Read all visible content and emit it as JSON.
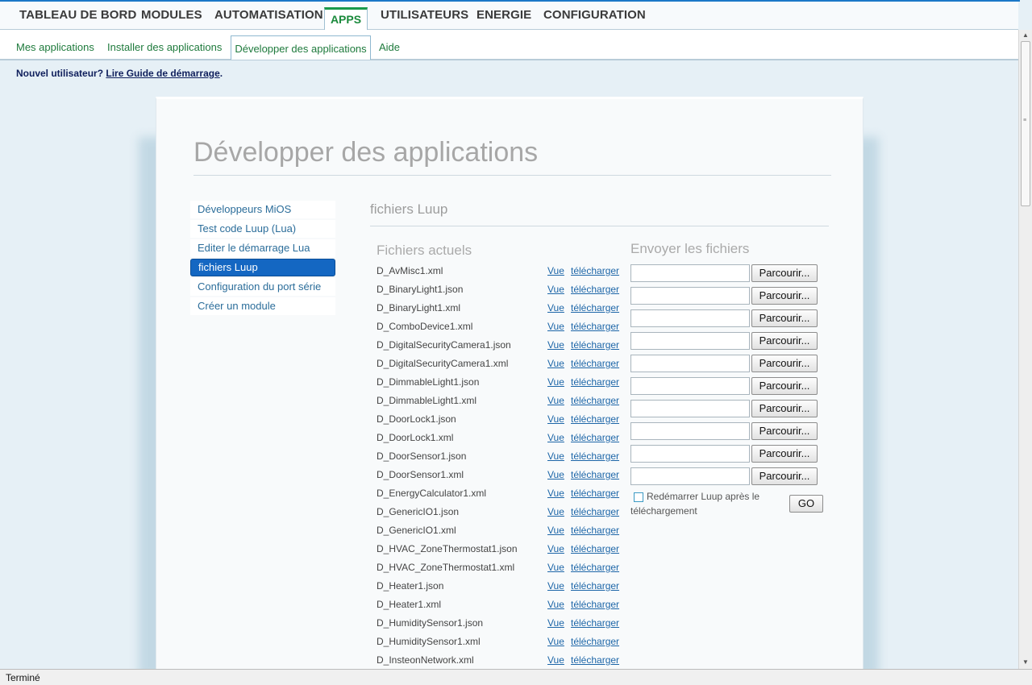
{
  "main_nav": {
    "items": [
      "TABLEAU DE BORD",
      "MODULES",
      "AUTOMATISATION",
      "UTILISATEURS",
      "ENERGIE",
      "CONFIGURATION"
    ],
    "active": "APPS"
  },
  "sub_nav": {
    "items": [
      "Mes applications",
      "Installer des applications",
      "Aide"
    ],
    "active": "Développer des applications"
  },
  "notice": {
    "text": "Nouvel utilisateur? ",
    "link": "Lire Guide de démarrage",
    "end": "."
  },
  "page": {
    "title": "Développer des applications"
  },
  "side_menu": {
    "items": [
      "Développeurs MiOS",
      "Test code Luup (Lua)",
      "Editer le démarrage Lua",
      "fichiers Luup",
      "Configuration du port série",
      "Créer un module"
    ]
  },
  "section": {
    "title": "fichiers Luup",
    "current_files_title": "Fichiers actuels",
    "upload_title": "Envoyer les fichiers",
    "view_label": "Vue",
    "download_label": "télécharger",
    "browse_label": "Parcourir...",
    "restart_label": "Redémarrer Luup après le téléchargement",
    "go_label": "GO"
  },
  "files": [
    "D_AvMisc1.xml",
    "D_BinaryLight1.json",
    "D_BinaryLight1.xml",
    "D_ComboDevice1.xml",
    "D_DigitalSecurityCamera1.json",
    "D_DigitalSecurityCamera1.xml",
    "D_DimmableLight1.json",
    "D_DimmableLight1.xml",
    "D_DoorLock1.json",
    "D_DoorLock1.xml",
    "D_DoorSensor1.json",
    "D_DoorSensor1.xml",
    "D_EnergyCalculator1.xml",
    "D_GenericIO1.json",
    "D_GenericIO1.xml",
    "D_HVAC_ZoneThermostat1.json",
    "D_HVAC_ZoneThermostat1.xml",
    "D_Heater1.json",
    "D_Heater1.xml",
    "D_HumiditySensor1.json",
    "D_HumiditySensor1.xml",
    "D_InsteonNetwork.xml"
  ],
  "status_bar": {
    "text": "Terminé"
  }
}
